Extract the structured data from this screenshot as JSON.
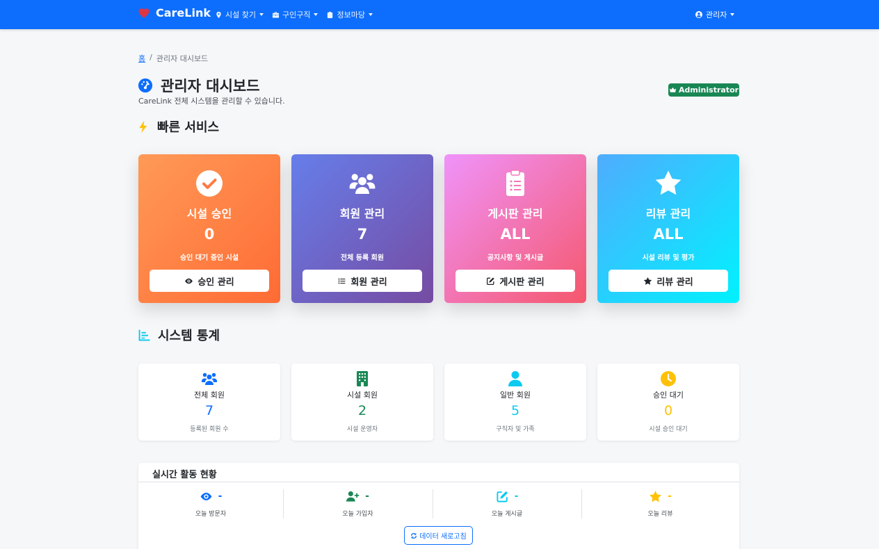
{
  "navbar": {
    "brand": "CareLink",
    "items": [
      {
        "label": "시설 찾기",
        "icon": "location-pin-icon"
      },
      {
        "label": "구인구직",
        "icon": "briefcase-icon"
      },
      {
        "label": "정보마당",
        "icon": "clipboard-icon"
      }
    ],
    "user": "관리자"
  },
  "breadcrumb": {
    "home": "홈",
    "separator": "/",
    "current": "관리자 대시보드"
  },
  "header": {
    "title": "관리자 대시보드",
    "subtitle": "CareLink 전체 시스템을 관리할 수 있습니다.",
    "badge": "Administrator"
  },
  "quick_services": {
    "title": "빠른 서비스",
    "cards": [
      {
        "label": "시설 승인",
        "count": "0",
        "desc": "승인 대기 중인 시설",
        "button": "승인 관리",
        "gradient": [
          "#ff9a56",
          "#ff6b35"
        ]
      },
      {
        "label": "회원 관리",
        "count": "7",
        "desc": "전체 등록 회원",
        "button": "회원 관리",
        "gradient": [
          "#667eea",
          "#764ba2"
        ]
      },
      {
        "label": "게시판 관리",
        "count": "ALL",
        "desc": "공지사항 및 게시글",
        "button": "게시판 관리",
        "gradient": [
          "#f093fb",
          "#f5576c"
        ]
      },
      {
        "label": "리뷰 관리",
        "count": "ALL",
        "desc": "시설 리뷰 및 평가",
        "button": "리뷰 관리",
        "gradient": [
          "#4facfe",
          "#00f2fe"
        ]
      }
    ]
  },
  "system_stats": {
    "title": "시스템 통계",
    "cards": [
      {
        "label": "전체 회원",
        "value": "7",
        "sub": "등록된 회원 수",
        "color": "#0d6efd"
      },
      {
        "label": "시설 회원",
        "value": "2",
        "sub": "시설 운영자",
        "color": "#198754"
      },
      {
        "label": "일반 회원",
        "value": "5",
        "sub": "구직자 및 가족",
        "color": "#0dcaf0"
      },
      {
        "label": "승인 대기",
        "value": "0",
        "sub": "시설 승인 대기",
        "color": "#ffc107"
      }
    ]
  },
  "realtime": {
    "title": "실시간 활동 현황",
    "items": [
      {
        "label": "오늘 방문자",
        "value": "-",
        "color": "#0d6efd"
      },
      {
        "label": "오늘 가입자",
        "value": "-",
        "color": "#198754"
      },
      {
        "label": "오늘 게시글",
        "value": "-",
        "color": "#0dcaf0"
      },
      {
        "label": "오늘 리뷰",
        "value": "-",
        "color": "#ffc107"
      }
    ],
    "refresh_button": "데이터 새로고침"
  }
}
